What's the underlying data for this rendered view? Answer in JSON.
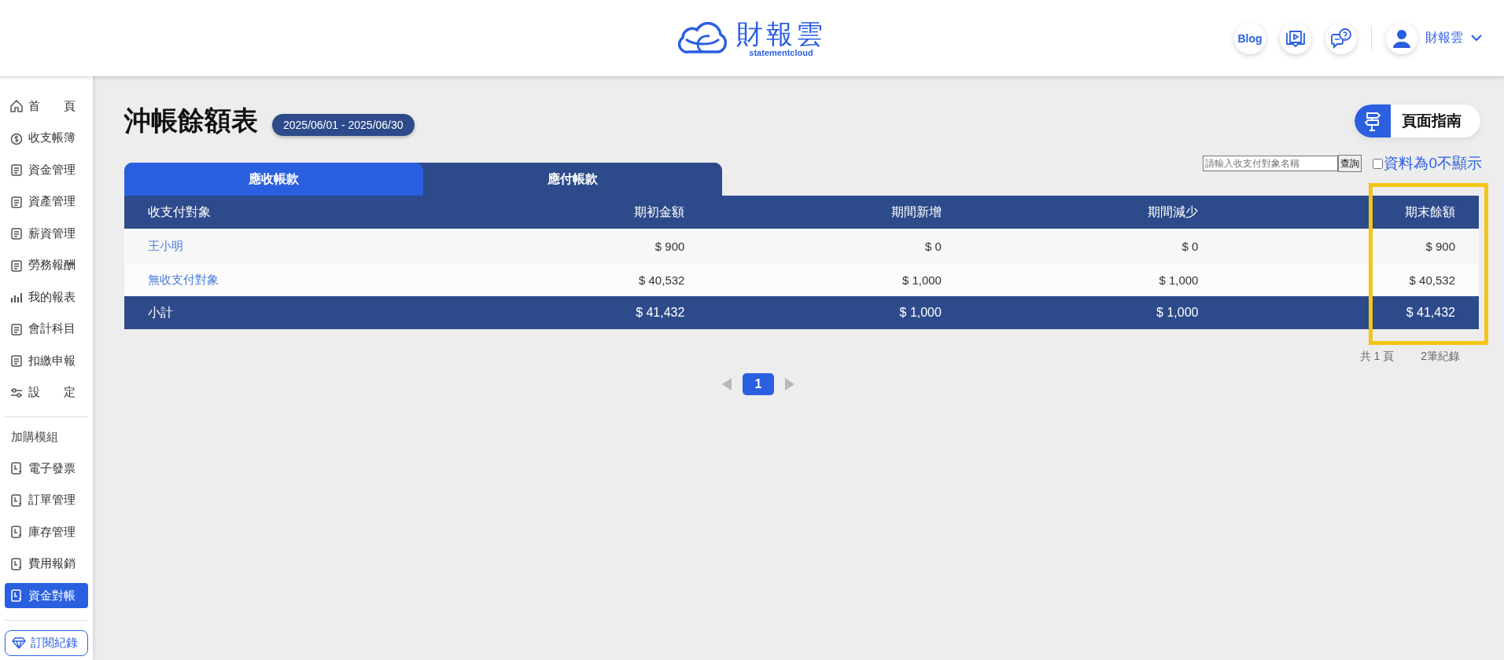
{
  "header": {
    "logo_text": "財報雲",
    "logo_subtext": "statementcloud",
    "blog_label": "Blog",
    "user_name": "財報雲"
  },
  "sidebar": {
    "items": [
      {
        "label": "首　　頁",
        "selected": false
      },
      {
        "label": "收支帳簿",
        "selected": false
      },
      {
        "label": "資金管理",
        "selected": false
      },
      {
        "label": "資產管理",
        "selected": false
      },
      {
        "label": "薪資管理",
        "selected": false
      },
      {
        "label": "勞務報酬",
        "selected": false
      },
      {
        "label": "我的報表",
        "selected": false
      },
      {
        "label": "會計科目",
        "selected": false
      },
      {
        "label": "扣繳申報",
        "selected": false
      },
      {
        "label": "設　　定",
        "selected": false
      }
    ],
    "addon_heading": "加購模組",
    "addon_items": [
      {
        "label": "電子發票",
        "selected": false
      },
      {
        "label": "訂單管理",
        "selected": false
      },
      {
        "label": "庫存管理",
        "selected": false
      },
      {
        "label": "費用報銷",
        "selected": false
      },
      {
        "label": "資金對帳",
        "selected": true
      }
    ],
    "subscription_button": "訂閱紀錄"
  },
  "page": {
    "title": "沖帳餘額表",
    "date_range": "2025/06/01 - 2025/06/30",
    "guide_button": "頁面指南"
  },
  "search": {
    "placeholder": "請輸入收支付對象名稱",
    "button": "查詢"
  },
  "hide_zero": {
    "label": "資料為0不顯示",
    "checked": false
  },
  "tabs": [
    {
      "label": "應收帳款",
      "selected": true
    },
    {
      "label": "應付帳款",
      "selected": false
    }
  ],
  "table": {
    "columns": [
      "收支付對象",
      "期初金額",
      "期間新增",
      "期間減少",
      "期末餘額"
    ],
    "rows": [
      [
        "王小明",
        "$ 900",
        "$ 0",
        "$ 0",
        "$ 900"
      ],
      [
        "無收支付對象",
        "$ 40,532",
        "$ 1,000",
        "$ 1,000",
        "$ 40,532"
      ]
    ],
    "subtotal": [
      "小計",
      "$ 41,432",
      "$ 1,000",
      "$ 1,000",
      "$ 41,432"
    ]
  },
  "summary": {
    "pages": "共 1 頁",
    "records": "2筆紀錄"
  },
  "pagination": {
    "pages": [
      {
        "label": "1",
        "selected": true
      }
    ]
  }
}
